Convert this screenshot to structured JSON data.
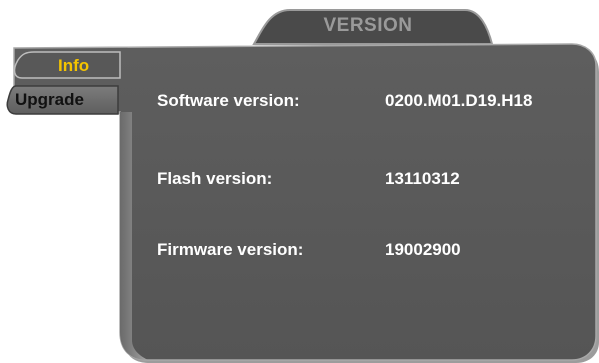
{
  "window": {
    "title": "VERSION"
  },
  "tabs": [
    {
      "label": "Info",
      "selected": true
    },
    {
      "label": "Upgrade",
      "selected": false
    }
  ],
  "info": {
    "rows": [
      {
        "label": "Software version:",
        "value": "0200.M01.D19.H18"
      },
      {
        "label": "Flash version:",
        "value": "13110312"
      },
      {
        "label": "Firmware version:",
        "value": "19002900"
      }
    ]
  },
  "colors": {
    "panel": "#585858",
    "title_tab": "#4a4a4a",
    "title_text": "#9a9a9a",
    "selected_tab_text": "#f5c400",
    "upgrade_tab": "#6e6e6e",
    "text": "#ffffff"
  }
}
